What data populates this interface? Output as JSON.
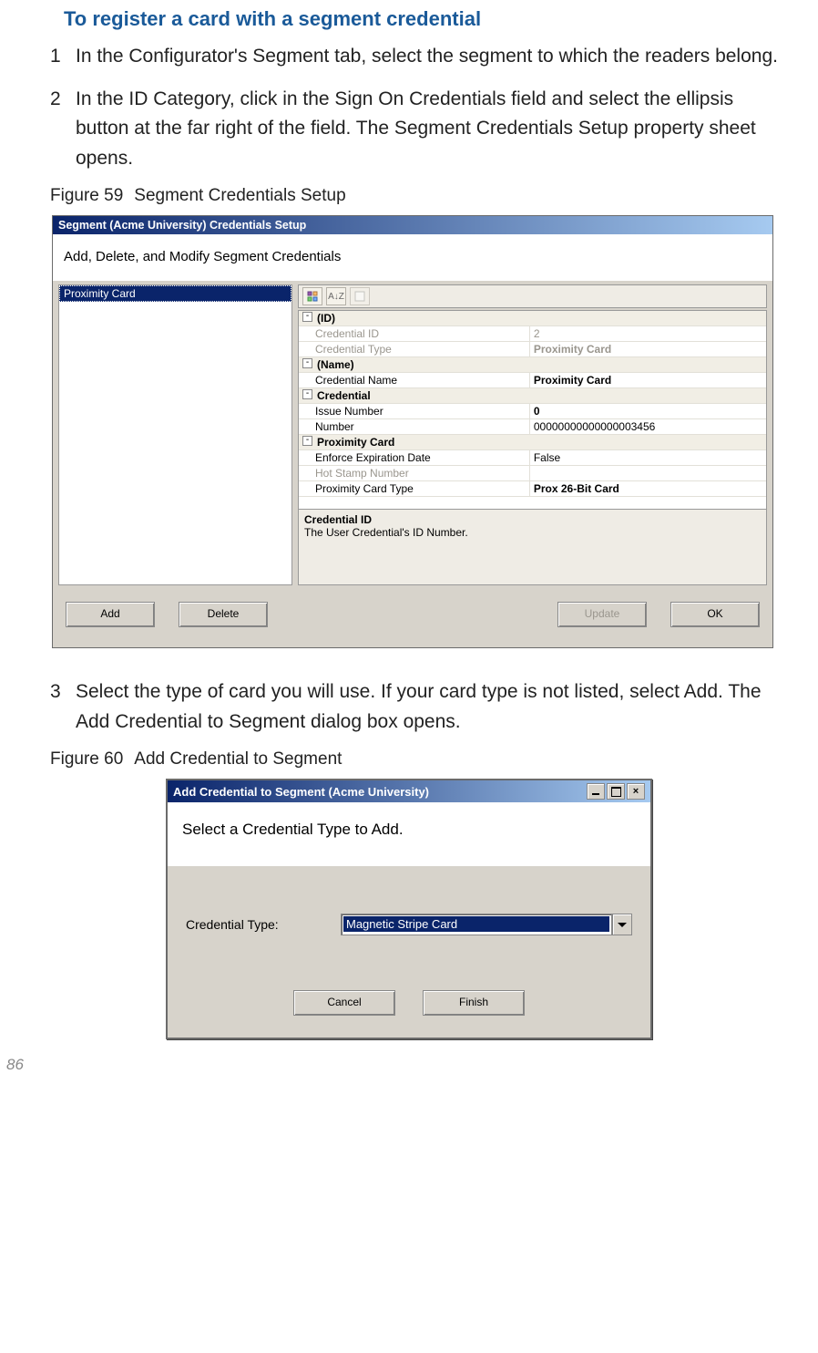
{
  "heading": "To register a card with a segment credential",
  "steps": {
    "s1": "In the Configurator's Segment tab, select the segment to which the readers belong.",
    "s2": "In the ID Category, click in the Sign On Credentials field and select the ellipsis button at the far right of the field. The Segment Credentials Setup property sheet opens.",
    "s3": "Select the type of card you will use. If your card type is not listed, select Add. The Add Credential to Segment dialog box opens."
  },
  "fig59": {
    "caption_no": "Figure 59",
    "caption_text": "Segment Credentials Setup",
    "title": "Segment (Acme University) Credentials Setup",
    "subtitle": "Add, Delete, and Modify Segment Credentials",
    "list_item": "Proximity Card",
    "cat_id": "(ID)",
    "row_cid_l": "Credential ID",
    "row_cid_v": "2",
    "row_ctype_l": "Credential Type",
    "row_ctype_v": "Proximity Card",
    "cat_name": "(Name)",
    "row_cname_l": "Credential Name",
    "row_cname_v": "Proximity Card",
    "cat_cred": "Credential",
    "row_issue_l": "Issue Number",
    "row_issue_v": "0",
    "row_num_l": "Number",
    "row_num_v": "00000000000000003456",
    "cat_prox": "Proximity Card",
    "row_exp_l": "Enforce Expiration Date",
    "row_exp_v": "False",
    "row_hot_l": "Hot Stamp Number",
    "row_hot_v": "",
    "row_pct_l": "Proximity Card Type",
    "row_pct_v": "Prox 26-Bit Card",
    "desc_title": "Credential ID",
    "desc_text": "The User Credential's ID Number.",
    "btn_add": "Add",
    "btn_delete": "Delete",
    "btn_update": "Update",
    "btn_ok": "OK"
  },
  "fig60": {
    "caption_no": "Figure 60",
    "caption_text": "Add Credential to Segment",
    "title": "Add Credential to Segment (Acme University)",
    "prompt": "Select a Credential Type to Add.",
    "label": "Credential Type:",
    "value": "Magnetic Stripe Card",
    "btn_cancel": "Cancel",
    "btn_finish": "Finish"
  },
  "tb": {
    "az": "A↓Z"
  },
  "pagenum": "86"
}
